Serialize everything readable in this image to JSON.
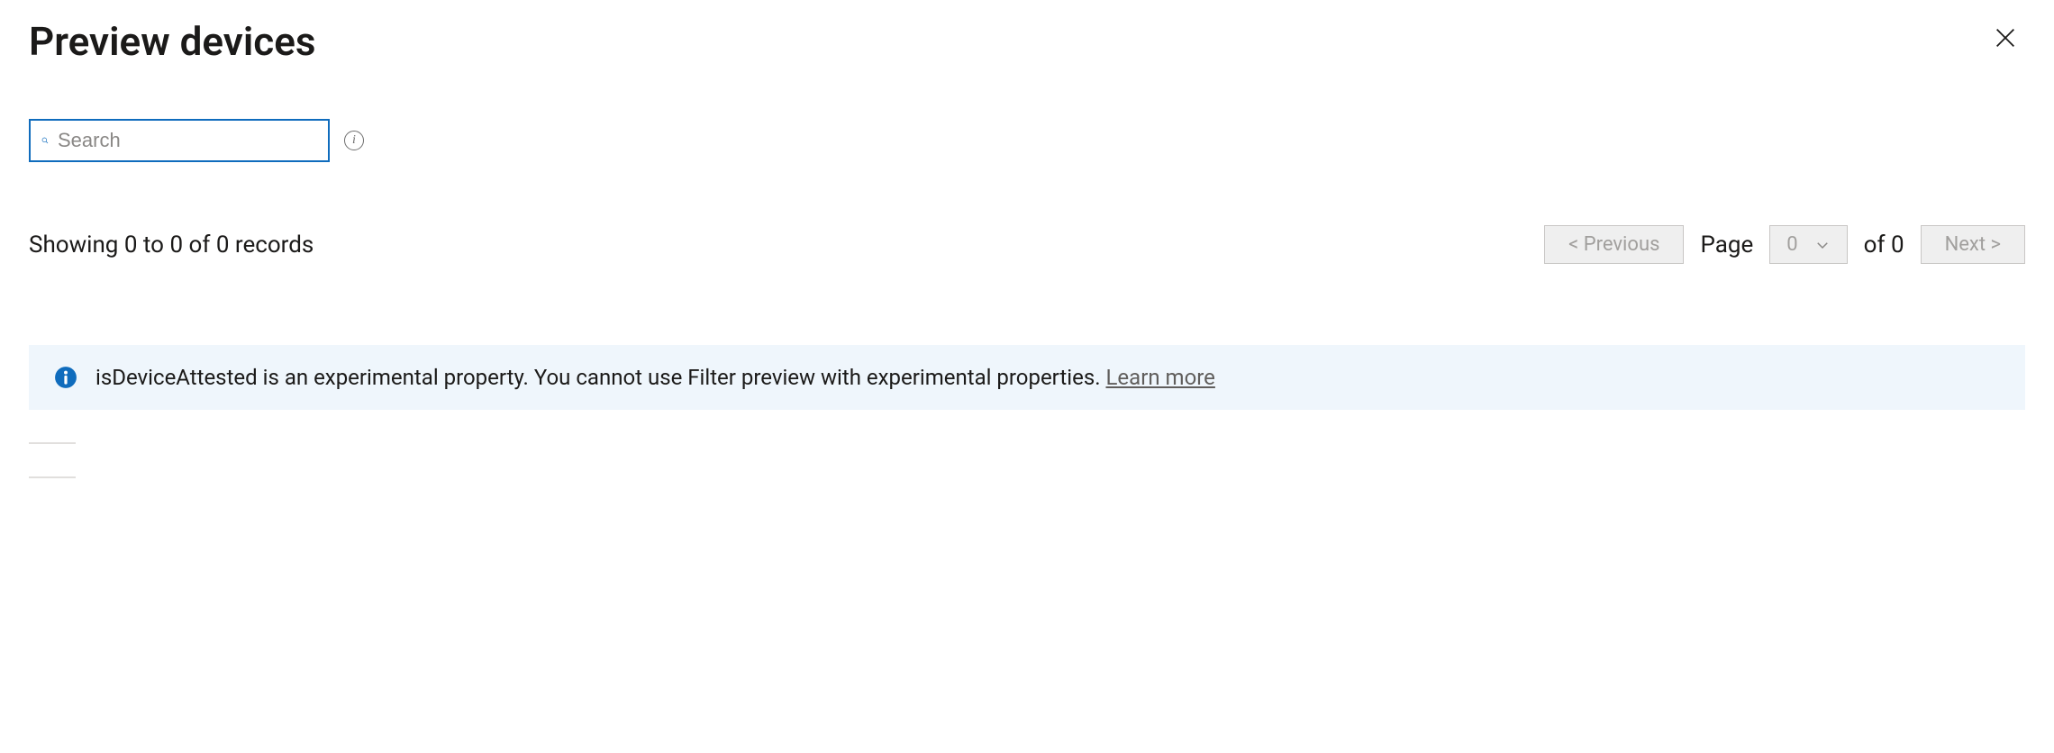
{
  "header": {
    "title": "Preview devices"
  },
  "search": {
    "placeholder": "Search"
  },
  "results": {
    "records_text": "Showing 0 to 0 of 0 records"
  },
  "pagination": {
    "previous_label": "<  Previous",
    "page_label": "Page",
    "page_value": "0",
    "of_label": "of 0",
    "next_label": "Next  >"
  },
  "banner": {
    "message": "isDeviceAttested is an experimental property. You cannot use Filter preview with experimental properties. ",
    "link_text": "Learn more"
  }
}
